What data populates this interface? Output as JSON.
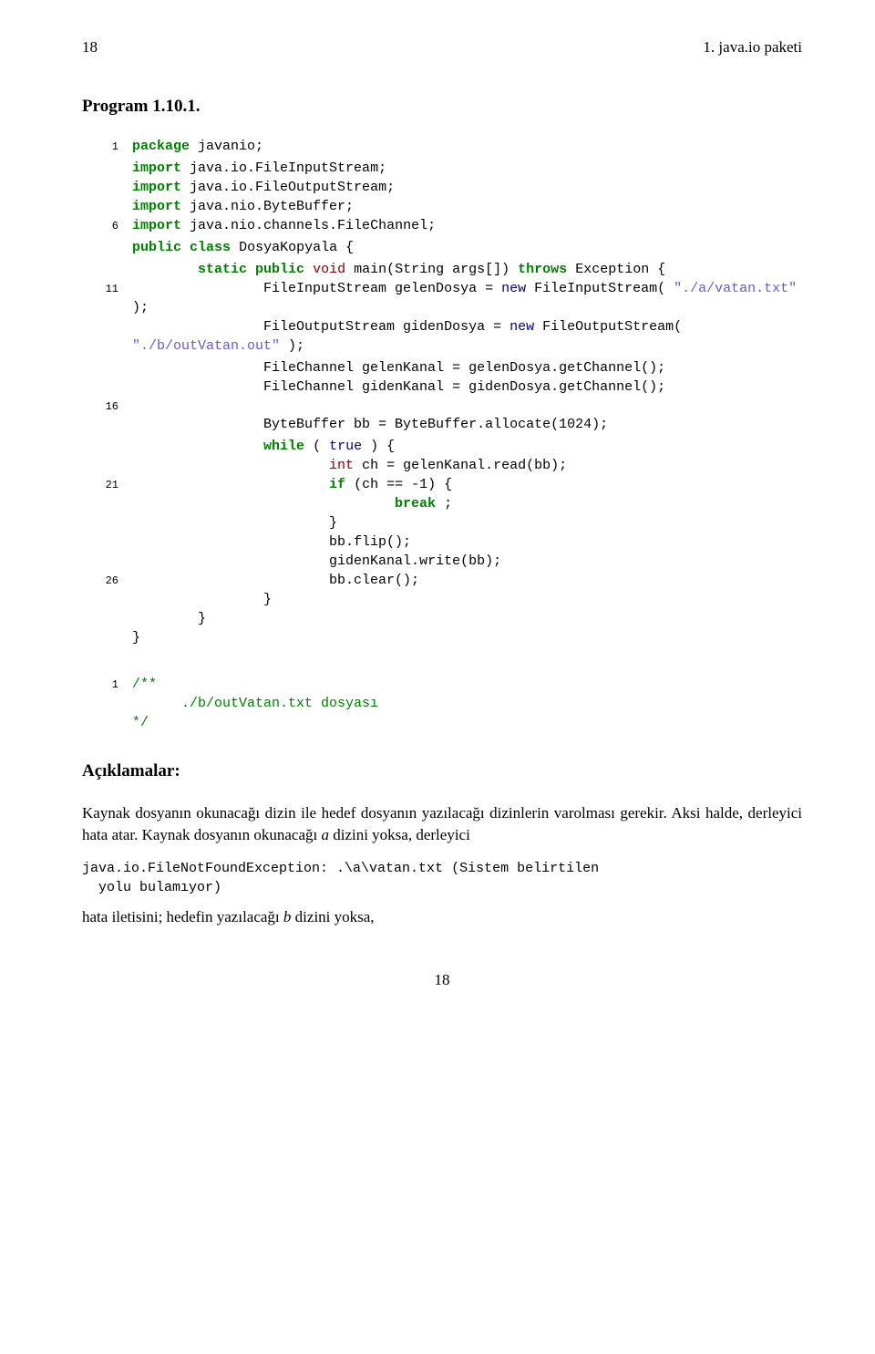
{
  "header": {
    "page_num": "18",
    "chapter": "1. java.io paketi"
  },
  "program_title": "Program 1.10.1.",
  "code": {
    "lines": [
      {
        "n": "1",
        "tokens": [
          [
            "kw-green",
            "package"
          ],
          [
            "",
            ""
          ],
          [
            "",
            "javanio;"
          ]
        ]
      },
      {
        "n": "",
        "tokens": [
          [
            "",
            ""
          ]
        ]
      },
      {
        "n": "",
        "tokens": [
          [
            "kw-green",
            "import"
          ],
          [
            "",
            "java.io.FileInputStream;"
          ]
        ]
      },
      {
        "n": "",
        "tokens": [
          [
            "kw-green",
            "import"
          ],
          [
            "",
            "java.io.FileOutputStream;"
          ]
        ]
      },
      {
        "n": "",
        "tokens": [
          [
            "kw-green",
            "import"
          ],
          [
            "",
            "java.nio.ByteBuffer;"
          ]
        ]
      },
      {
        "n": "6",
        "tokens": [
          [
            "kw-green",
            "import"
          ],
          [
            "",
            "java.nio.channels.FileChannel;"
          ]
        ]
      },
      {
        "n": "",
        "tokens": [
          [
            "",
            ""
          ]
        ]
      },
      {
        "n": "",
        "tokens": [
          [
            "kw-green",
            "public"
          ],
          [
            "kw-green",
            "class"
          ],
          [
            "",
            "DosyaKopyala {"
          ]
        ]
      },
      {
        "n": "",
        "tokens": [
          [
            "",
            ""
          ]
        ]
      },
      {
        "n": "",
        "tokens": [
          [
            "",
            "        "
          ],
          [
            "kw-green",
            "static"
          ],
          [
            "kw-green",
            "public"
          ],
          [
            "kw-red",
            "void"
          ],
          [
            "",
            "main(String args[])"
          ],
          [
            "kw-green",
            "throws"
          ],
          [
            "",
            "Exception {"
          ]
        ]
      },
      {
        "n": "11",
        "tokens": [
          [
            "",
            "                FileInputStream gelenDosya = "
          ],
          [
            "kw-blue",
            "new"
          ],
          [
            "",
            "FileInputStream("
          ],
          [
            "kw-mauve",
            "\"./a/vatan.txt\""
          ],
          [
            "",
            ");"
          ]
        ]
      },
      {
        "n": "",
        "tokens": [
          [
            "",
            "                FileOutputStream gidenDosya = "
          ],
          [
            "kw-blue",
            "new"
          ],
          [
            "",
            "FileOutputStream("
          ],
          [
            "kw-mauve",
            "\"./b/outVatan.out\""
          ],
          [
            "",
            ");"
          ]
        ]
      },
      {
        "n": "",
        "tokens": [
          [
            "",
            ""
          ]
        ]
      },
      {
        "n": "",
        "tokens": [
          [
            "",
            "                FileChannel gelenKanal = gelenDosya.getChannel();"
          ]
        ]
      },
      {
        "n": "",
        "tokens": [
          [
            "",
            "                FileChannel gidenKanal = gidenDosya.getChannel();"
          ]
        ]
      },
      {
        "n": "16",
        "tokens": [
          [
            "",
            ""
          ]
        ]
      },
      {
        "n": "",
        "tokens": [
          [
            "",
            "                ByteBuffer bb = ByteBuffer.allocate(1024);"
          ]
        ]
      },
      {
        "n": "",
        "tokens": [
          [
            "",
            ""
          ]
        ]
      },
      {
        "n": "",
        "tokens": [
          [
            "",
            "                "
          ],
          [
            "kw-green",
            "while"
          ],
          [
            "",
            "("
          ],
          [
            "kw-blue",
            "true"
          ],
          [
            "",
            ") {"
          ]
        ]
      },
      {
        "n": "",
        "tokens": [
          [
            "",
            "                        "
          ],
          [
            "kw-red",
            "int"
          ],
          [
            "",
            "ch = gelenKanal.read(bb);"
          ]
        ]
      },
      {
        "n": "21",
        "tokens": [
          [
            "",
            "                        "
          ],
          [
            "kw-green",
            "if"
          ],
          [
            "",
            "(ch == -1) {"
          ]
        ]
      },
      {
        "n": "",
        "tokens": [
          [
            "",
            "                                "
          ],
          [
            "kw-green",
            "break"
          ],
          [
            "",
            ";"
          ]
        ]
      },
      {
        "n": "",
        "tokens": [
          [
            "",
            "                        }"
          ]
        ]
      },
      {
        "n": "",
        "tokens": [
          [
            "",
            "                        bb.flip();"
          ]
        ]
      },
      {
        "n": "",
        "tokens": [
          [
            "",
            "                        gidenKanal.write(bb);"
          ]
        ]
      },
      {
        "n": "26",
        "tokens": [
          [
            "",
            "                        bb.clear();"
          ]
        ]
      },
      {
        "n": "",
        "tokens": [
          [
            "",
            "                }"
          ]
        ]
      },
      {
        "n": "",
        "tokens": [
          [
            "",
            "        }"
          ]
        ]
      },
      {
        "n": "",
        "tokens": [
          [
            "",
            "}"
          ]
        ]
      }
    ]
  },
  "code2": {
    "lines": [
      {
        "n": "1",
        "tokens": [
          [
            "comment",
            "/**"
          ]
        ]
      },
      {
        "n": "",
        "tokens": [
          [
            "comment",
            "      ./b/outVatan.txt dosyası"
          ]
        ]
      },
      {
        "n": "",
        "tokens": [
          [
            "comment",
            "*/"
          ]
        ]
      }
    ]
  },
  "section": "Açıklamalar:",
  "para1_a": "Kaynak dosyanın okunacağı dizin ile hedef dosyanın yazılacağı dizinlerin varolması gerekir. Aksi halde, derleyici hata atar. Kaynak dosyanın okunacağı ",
  "para1_italic": "a",
  "para1_b": " dizini yoksa, derleyici",
  "inline_err": "java.io.FileNotFoundException: .\\a\\vatan.txt (Sistem belirtilen\n  yolu bulamıyor)",
  "para2_a": "hata iletisini; hedefin yazılacağı ",
  "para2_italic": "b",
  "para2_b": " dizini yoksa,",
  "footer_page": "18"
}
